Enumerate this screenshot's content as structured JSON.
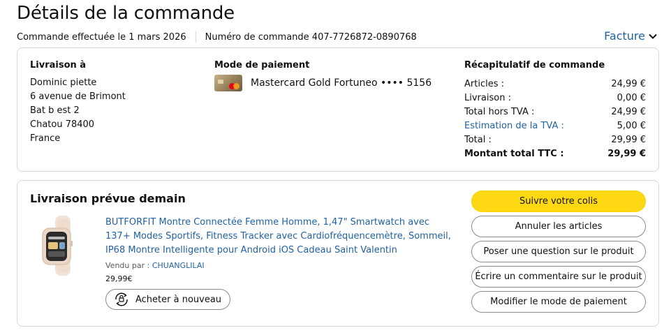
{
  "header": {
    "title": "Détails de la commande",
    "order_date": "Commande effectuée le 1 mars 2026",
    "order_number": "Numéro de commande 407-7726872-0890768",
    "invoice_label": "Facture"
  },
  "shipping": {
    "title": "Livraison à",
    "lines": [
      "Dominic piette",
      "6 avenue de Brimont",
      "Bat b est 2",
      "Chatou 78400",
      "France"
    ]
  },
  "payment": {
    "title": "Mode de paiement",
    "card_text": "Mastercard Gold Fortuneo •••• 5156"
  },
  "summary": {
    "title": "Récapitulatif de commande",
    "rows": [
      {
        "label": "Articles :",
        "value": "24,99 €"
      },
      {
        "label": "Livraison :",
        "value": "0,00 €"
      },
      {
        "label": "Total hors TVA :",
        "value": "24,99 €"
      },
      {
        "label": "Estimation de la TVA :",
        "value": "5,00 €"
      },
      {
        "label": "Total :",
        "value": "29,99 €"
      },
      {
        "label": "Montant total TTC :",
        "value": "29,99 €"
      }
    ]
  },
  "delivery": {
    "title": "Livraison prévue demain",
    "product_title": "BUTFORFIT Montre Connectée Femme Homme, 1,47\" Smartwatch avec 137+ Modes Sportifs, Fitness Tracker avec Cardiofréquencemètre, Sommeil, IP68 Montre Intelligente pour Android iOS Cadeau Saint Valentin",
    "sold_by_label": "Vendu par  : ",
    "seller": "CHUANGLILAI",
    "price": "29,99€",
    "rebuy_label": "Acheter à nouveau"
  },
  "actions": {
    "track": "Suivre votre colis",
    "cancel": "Annuler les articles",
    "question": "Poser une question sur le produit",
    "review": "Écrire un commentaire sur le produit",
    "change_payment": "Modifier le mode de paiement"
  },
  "colors": {
    "link": "#2162a1",
    "primary_button": "#ffd814",
    "border": "#d5d9d9"
  },
  "icons": {
    "invoice_chevron": "chevron-down-icon",
    "card": "mastercard-icon",
    "rebuy": "rebuy-cart-icon"
  }
}
